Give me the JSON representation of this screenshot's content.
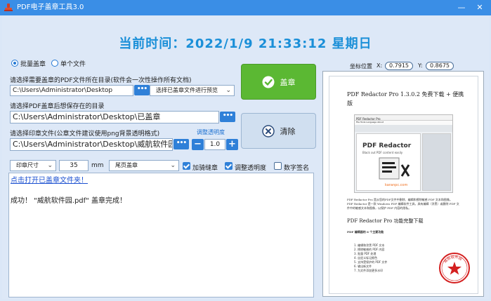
{
  "window": {
    "title": "PDF电子盖章工具3.0",
    "minimize_glyph": "—",
    "close_glyph": "✕",
    "icon": "stamp-icon"
  },
  "clock": "当前时间：2022/1/9 21:33:12  星期日",
  "mode": {
    "batch_label": "批量盖章",
    "single_label": "单个文件",
    "selected": "batch"
  },
  "source": {
    "label": "请选择需要盖章的PDF文件所在目录(软件会一次性操作所有文档)",
    "value": "C:\\Users\\Administrator\\Desktop",
    "browse": "•••",
    "filter_selected": "选择已盖章文件进行预览"
  },
  "output": {
    "label": "请选择PDF盖章后想保存在的目录",
    "value": "C:\\Users\\Administrator\\Desktop\\已盖章",
    "browse": "•••"
  },
  "seal": {
    "label": "请选择印章文件(公章文件建议使用png背景透明格式)",
    "value": "C:\\Users\\Administrator\\Desktop\\威航软件园",
    "browse": "•••"
  },
  "opacity": {
    "link": "调整透明度",
    "minus": "−",
    "plus": "+",
    "value": "1.0"
  },
  "options": {
    "size_selected": "印章尺寸",
    "size_value": "35",
    "size_unit": "mm",
    "page_selected": "尾页盖章",
    "seam_label": "加骑缝章",
    "seam_checked": true,
    "opacity_label": "调整透明度",
    "opacity_checked": true,
    "digital_label": "数字签名",
    "digital_checked": false
  },
  "buttons": {
    "stamp": "盖章",
    "clear": "清除"
  },
  "log": {
    "open_link": "点击打开已盖章文件夹！",
    "message": "成功！ \"威航软件园.pdf\" 盖章完成！"
  },
  "coords": {
    "label": "坐标位置",
    "x_label": "X:",
    "x": "0.7915",
    "y_label": "Y:",
    "y": "0.8675"
  },
  "preview": {
    "title": "PDF Redactor Pro 1.3.0.2 免费下载 + 便携版",
    "app_window_title": "PDF Redactor Pro",
    "app_menu": "File  Tools  Language  About",
    "brand": "PDF Redactor",
    "tagline": "Black out PDF content easily",
    "site": "karanpc.com",
    "body_lines": [
      "PDF Redactor Pro 是从您的PDF文件中删除、编辑和擦除敏感 PDF 文本和图像。",
      "PDF Redactor 是一款 Windows PDF 编辑软件工具，具有编辑（涂黑）或删除 PDF 文",
      "件中的敏感文本和图像，以保护 PDF 内容的隐私。"
    ],
    "section_title": "PDF Redactor Pro 功能完整下载",
    "features_title": "PDF 编辑器的 6 个主要功能",
    "features": [
      "1.  编辑和涂黑 PDF 文本",
      "2.  擦除敏感的 PDF 内容",
      "3.  批量 PDF 处理",
      "4.  自定义标记颜色",
      "5.  支持受保护的 PDF 文件",
      "6.  输出新文件",
      "7.  为文件添加更多水印"
    ],
    "seal_text": "威航软件园"
  }
}
